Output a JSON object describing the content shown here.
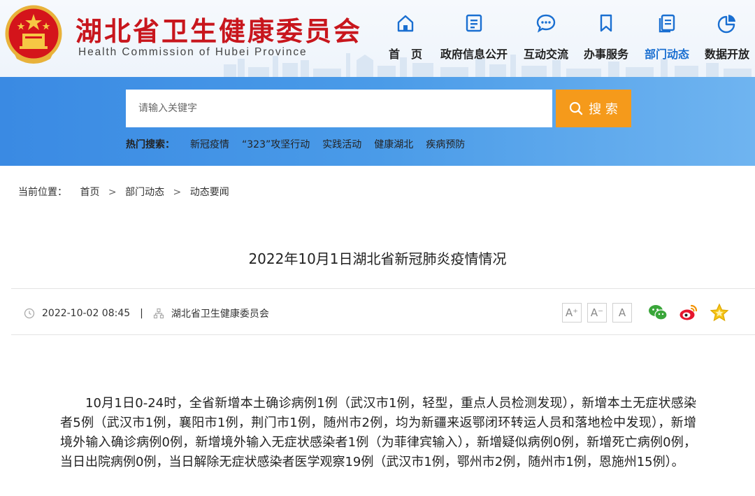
{
  "header": {
    "title": "湖北省卫生健康委员会",
    "subtitle": "Health Commission of Hubei Province"
  },
  "nav": [
    {
      "label": "首　页",
      "icon": "home-icon"
    },
    {
      "label": "政府信息公开",
      "icon": "document-icon"
    },
    {
      "label": "互动交流",
      "icon": "chat-icon"
    },
    {
      "label": "办事服务",
      "icon": "bookmark-icon"
    },
    {
      "label": "部门动态",
      "icon": "news-icon",
      "active": true
    },
    {
      "label": "数据开放",
      "icon": "pie-chart-icon"
    }
  ],
  "search": {
    "placeholder": "请输入关键字",
    "button_label": "搜 索",
    "hot_label": "热门搜索：",
    "hot_items": [
      "新冠疫情",
      "“323”攻坚行动",
      "实践活动",
      "健康湖北",
      "疾病预防"
    ]
  },
  "breadcrumb": {
    "prefix": "当前位置：",
    "items": [
      "首页",
      "部门动态",
      "动态要闻"
    ],
    "separator": ">"
  },
  "article": {
    "title": "2022年10月1日湖北省新冠肺炎疫情情况",
    "date": "2022-10-02 08:45",
    "meta_separator": "|",
    "source": "湖北省卫生健康委员会",
    "font_sizes": [
      "A⁺",
      "A⁻",
      "A"
    ],
    "share": [
      "wechat-icon",
      "weibo-icon",
      "favorite-star-icon"
    ],
    "body": "10月1日0-24时，全省新增本土确诊病例1例（武汉市1例，轻型，重点人员检测发现），新增本土无症状感染者5例（武汉市1例，襄阳市1例，荆门市1例，随州市2例，均为新疆来返鄂闭环转运人员和落地检中发现），新增境外输入确诊病例0例，新增境外输入无症状感染者1例（为菲律宾输入），新增疑似病例0例，新增死亡病例0例，当日出院病例0例，当日解除无症状感染者医学观察19例（武汉市1例，鄂州市2例，随州市1例，恩施州15例）。"
  },
  "colors": {
    "brand_red": "#c8161d",
    "nav_active": "#1a6fd1",
    "search_band": "#3a8ae3",
    "search_button": "#f59a1b"
  }
}
